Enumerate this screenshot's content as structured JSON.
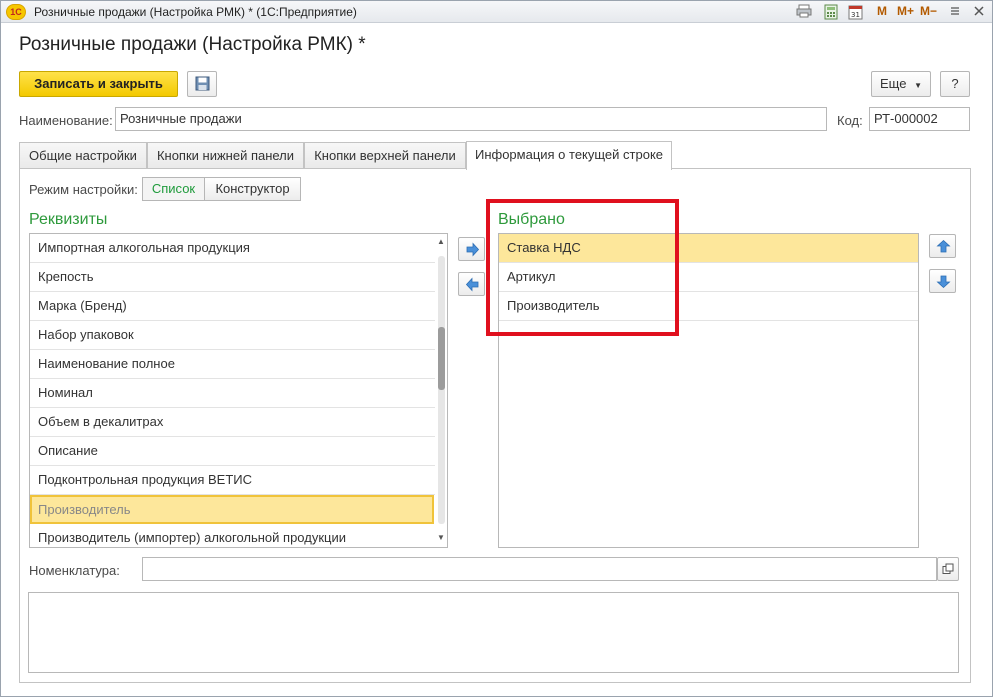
{
  "window": {
    "title": "Розничные продажи (Настройка РМК) * (1С:Предприятие)",
    "logo_text": "1С",
    "mem_buttons": [
      "M",
      "M+",
      "M−"
    ]
  },
  "form": {
    "title": "Розничные продажи (Настройка РМК) *",
    "save_close_label": "Записать и закрыть",
    "more_label": "Еще",
    "help_label": "?",
    "name_label": "Наименование:",
    "name_value": "Розничные продажи",
    "code_label": "Код:",
    "code_value": "РТ-000002"
  },
  "tabs": [
    {
      "label": "Общие настройки"
    },
    {
      "label": "Кнопки нижней панели"
    },
    {
      "label": "Кнопки верхней панели"
    },
    {
      "label": "Информация о текущей строке",
      "active": true
    }
  ],
  "mode": {
    "label": "Режим настройки:",
    "options": [
      "Список",
      "Конструктор"
    ],
    "selected": "Список"
  },
  "requisites": {
    "title": "Реквизиты",
    "items": [
      "Импортная алкогольная продукция",
      "Крепость",
      "Марка (Бренд)",
      "Набор упаковок",
      "Наименование полное",
      "Номинал",
      "Объем в декалитрах",
      "Описание",
      "Подконтрольная продукция ВЕТИС",
      "Производитель",
      "Производитель (импортер) алкогольной продукции"
    ],
    "selected_index": 9
  },
  "chosen": {
    "title": "Выбрано",
    "items": [
      "Ставка НДС",
      "Артикул",
      "Производитель"
    ],
    "selected_index": 0
  },
  "nomenclature": {
    "label": "Номенклатура:",
    "value": ""
  },
  "colors": {
    "accent_green": "#2e9a3c",
    "highlight": "#fde79b",
    "primary_button": "#f3c900",
    "annotation_red": "#e0101e"
  }
}
